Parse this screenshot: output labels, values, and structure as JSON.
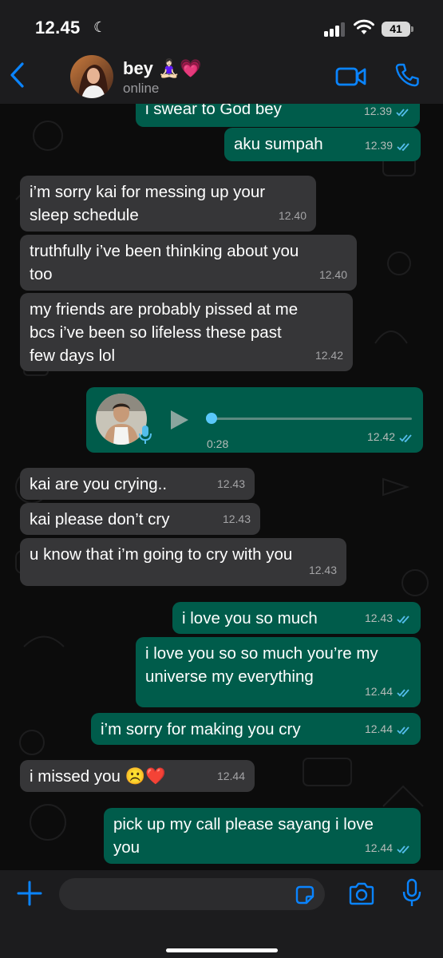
{
  "status_bar": {
    "time": "12.45",
    "battery": "41",
    "moon_icon": "moon-icon",
    "signal_icon": "cellular-signal-icon",
    "wifi_icon": "wifi-icon"
  },
  "header": {
    "contact_name": "bey 🧘🏻‍♀️💗",
    "contact_status": "online",
    "back_icon": "chevron-left-icon",
    "video_icon": "video-camera-icon",
    "call_icon": "phone-icon",
    "accent": "#0a84ff"
  },
  "messages": [
    {
      "dir": "out",
      "text": "i swear to God bey",
      "time": "12.39",
      "read": true
    },
    {
      "dir": "out",
      "text": "aku sumpah",
      "time": "12.39",
      "read": true
    },
    {
      "dir": "in",
      "text": "i’m sorry kai for messing up your\nsleep schedule",
      "time": "12.40"
    },
    {
      "dir": "in",
      "text": "truthfully i’ve been thinking about you\ntoo",
      "time": "12.40"
    },
    {
      "dir": "in",
      "text": "my friends are probably pissed at me\nbcs i’ve been so lifeless these past\nfew days lol",
      "time": "12.42"
    },
    {
      "dir": "out",
      "type": "voice",
      "duration": "0:28",
      "time": "12.42",
      "read": true,
      "progress": 0
    },
    {
      "dir": "in",
      "text": "kai are you crying..",
      "time": "12.43"
    },
    {
      "dir": "in",
      "text": "kai please don’t cry",
      "time": "12.43"
    },
    {
      "dir": "in",
      "text": "u know that i’m going to cry with you",
      "time": "12.43"
    },
    {
      "dir": "out",
      "text": "i love you so much",
      "time": "12.43",
      "read": true
    },
    {
      "dir": "out",
      "text": "i love you so so much you’re my\nuniverse my everything",
      "time": "12.44",
      "read": true
    },
    {
      "dir": "out",
      "text": "i’m sorry for making you cry",
      "time": "12.44",
      "read": true
    },
    {
      "dir": "in",
      "text": "i missed you ☹️❤️",
      "time": "12.44"
    },
    {
      "dir": "out",
      "text": "pick up my call please sayang i love\nyou",
      "time": "12.44",
      "read": true
    }
  ],
  "input_bar": {
    "placeholder": "",
    "plus_icon": "plus-icon",
    "sticker_icon": "sticker-icon",
    "camera_icon": "camera-icon",
    "mic_icon": "microphone-icon"
  },
  "colors": {
    "incoming_bubble": "#363638",
    "outgoing_bubble": "#005c4b",
    "read_ticks": "#53bdeb"
  }
}
